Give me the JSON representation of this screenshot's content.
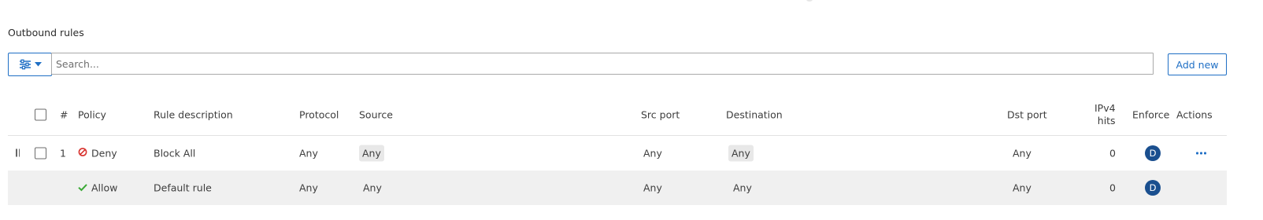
{
  "section": {
    "title": "Outbound rules"
  },
  "toolbar": {
    "filter_icon": "sliders-icon",
    "search_placeholder": "Search...",
    "add_label": "Add new"
  },
  "table": {
    "headers": {
      "number": "#",
      "policy": "Policy",
      "description": "Rule description",
      "protocol": "Protocol",
      "source": "Source",
      "src_port": "Src port",
      "destination": "Destination",
      "dst_port": "Dst port",
      "ipv4_hits_line1": "IPv4",
      "ipv4_hits_line2": "hits",
      "enforce": "Enforce",
      "actions": "Actions"
    },
    "rows": [
      {
        "number": "1",
        "policy": "Deny",
        "policy_icon": "deny-icon",
        "description": "Block All",
        "protocol": "Any",
        "source": "Any",
        "src_port": "Any",
        "destination": "Any",
        "dst_port": "Any",
        "ipv4_hits": "0",
        "enforce": "D"
      },
      {
        "policy": "Allow",
        "policy_icon": "check-icon",
        "description": "Default rule",
        "protocol": "Any",
        "source": "Any",
        "src_port": "Any",
        "destination": "Any",
        "dst_port": "Any",
        "ipv4_hits": "0",
        "enforce": "D"
      }
    ]
  },
  "colors": {
    "accent": "#1f6fc5",
    "deny": "#d8322e",
    "allow": "#3aa935",
    "enforce_badge": "#1a4f8f"
  }
}
